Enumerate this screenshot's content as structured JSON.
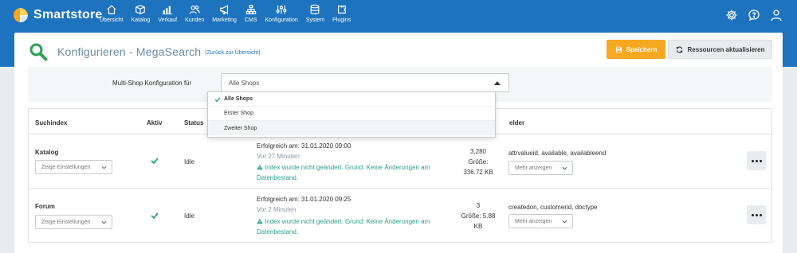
{
  "brand": {
    "name": "Smartstore"
  },
  "nav": {
    "items": [
      {
        "label": "Übersicht",
        "icon": "home-icon"
      },
      {
        "label": "Katalog",
        "icon": "box-icon"
      },
      {
        "label": "Verkauf",
        "icon": "bar-chart-icon"
      },
      {
        "label": "Kunden",
        "icon": "users-icon"
      },
      {
        "label": "Marketing",
        "icon": "megaphone-icon"
      },
      {
        "label": "CMS",
        "icon": "sitemap-icon"
      },
      {
        "label": "Konfiguration",
        "icon": "sliders-icon"
      },
      {
        "label": "System",
        "icon": "database-icon"
      },
      {
        "label": "Plugins",
        "icon": "puzzle-icon"
      }
    ],
    "right_icons": [
      "gear-icon",
      "help-chat-icon",
      "user-icon"
    ]
  },
  "page": {
    "title": "Konfigurieren - MegaSearch",
    "back_link": "(Zurück zur Übersicht)",
    "save_label": "Speichern",
    "refresh_label": "Ressourcen aktualisieren"
  },
  "config": {
    "label": "Multi-Shop Konfiguration für",
    "selected": "Alle Shops",
    "options": [
      "Alle Shops",
      "Erster Shop",
      "Zweiter Shop"
    ]
  },
  "table": {
    "headers": {
      "index": "Suchindex",
      "active": "Aktiv",
      "status": "Status",
      "fields": "elder"
    },
    "rows": [
      {
        "name": "Katalog",
        "settings_label": "Zeige Einstellungen",
        "status": "Idle",
        "success": "Erfolgreich am: 31.01.2020 09:00",
        "ago": "Vor 27 Minuten",
        "info": "Index wurde nicht geändert. Grund: Keine Änderungen am Datenbestand.",
        "count": "3,280",
        "size_label": "Größe:",
        "size": "336.72 KB",
        "fields": "attrvalueid, available, availableend",
        "more_label": "Mehr anzeigen"
      },
      {
        "name": "Forum",
        "settings_label": "Zeige Einstellungen",
        "status": "Idle",
        "success": "Erfolgreich am: 31.01.2020 09:25",
        "ago": "Vor 2 Minuten",
        "info": "Index wurde nicht geändert. Grund: Keine Änderungen am Datenbestand.",
        "count": "3",
        "size_label": "Größe: 5.88",
        "size": "KB",
        "fields": "createdon, customerid, doctype",
        "more_label": "Mehr anzeigen"
      }
    ]
  },
  "colors": {
    "nav_bg": "#1e73be",
    "save": "#f7a823",
    "info": "#2a9d8f",
    "check": "#2a9d8f"
  }
}
